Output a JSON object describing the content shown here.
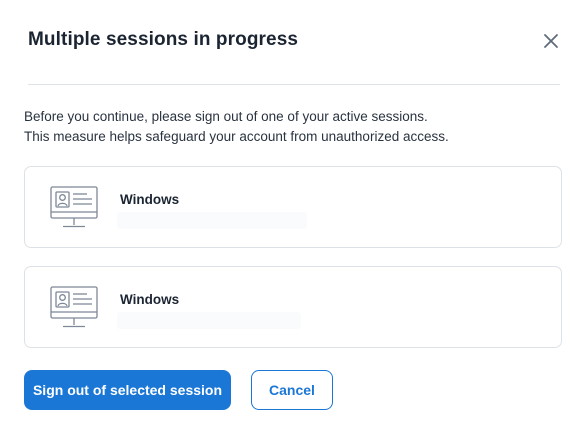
{
  "dialog": {
    "title": "Multiple sessions in progress",
    "description_line1": "Before you continue, please sign out of one of your active sessions.",
    "description_line2": "This measure helps safeguard your account from unauthorized access."
  },
  "sessions": [
    {
      "name": "Windows",
      "icon": "computer-monitor-icon"
    },
    {
      "name": "Windows",
      "icon": "computer-monitor-icon"
    }
  ],
  "actions": {
    "primary_label": "Sign out of selected session",
    "secondary_label": "Cancel"
  },
  "colors": {
    "accent": "#1b77d6",
    "title": "#1b2532",
    "border": "#dde2e8",
    "icon_stroke": "#7e8896"
  }
}
